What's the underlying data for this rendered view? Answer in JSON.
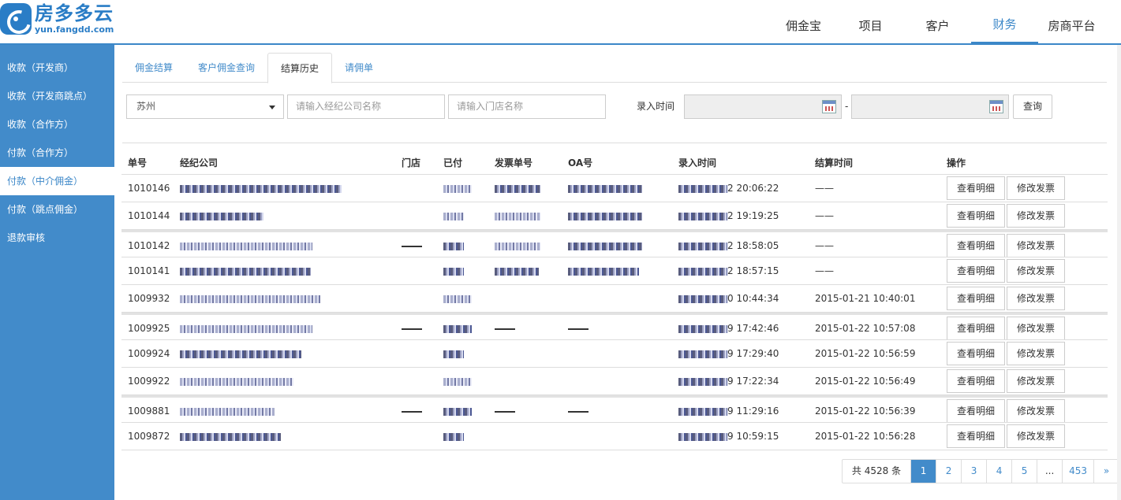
{
  "brand": {
    "name_cn": "房多多云",
    "domain": "yun.fangdd.com"
  },
  "topnav": [
    {
      "label": "佣金宝",
      "active": false
    },
    {
      "label": "项目",
      "active": false
    },
    {
      "label": "客户",
      "active": false
    },
    {
      "label": "财务",
      "active": true
    },
    {
      "label": "房商平台",
      "active": false
    }
  ],
  "sidebar": [
    {
      "label": "收款（开发商）",
      "active": false
    },
    {
      "label": "收款（开发商跳点）",
      "active": false
    },
    {
      "label": "收款（合作方）",
      "active": false
    },
    {
      "label": "付款（合作方）",
      "active": false
    },
    {
      "label": "付款（中介佣金）",
      "active": true
    },
    {
      "label": "付款（跳点佣金）",
      "active": false
    },
    {
      "label": "退款审核",
      "active": false
    }
  ],
  "tabs": [
    {
      "label": "佣金结算",
      "active": false
    },
    {
      "label": "客户佣金查询",
      "active": false
    },
    {
      "label": "结算历史",
      "active": true
    },
    {
      "label": "请佣单",
      "active": false
    }
  ],
  "filters": {
    "city": "苏州",
    "company_placeholder": "请输入经纪公司名称",
    "store_placeholder": "请输入门店名称",
    "time_label": "录入时间",
    "range_sep": "-",
    "query_button": "查询"
  },
  "table": {
    "headers": [
      "单号",
      "经纪公司",
      "门店",
      "已付",
      "发票单号",
      "OA号",
      "录入时间",
      "结算时间",
      "操作"
    ],
    "rows": [
      {
        "id": "1010146",
        "rec_suffix": "2 20:06:22",
        "settle": "——"
      },
      {
        "id": "1010144",
        "rec_suffix": "2 19:19:25",
        "settle": "——"
      },
      {
        "id": "1010142",
        "rec_suffix": "2 18:58:05",
        "settle": "——"
      },
      {
        "id": "1010141",
        "rec_suffix": "2 18:57:15",
        "settle": "——"
      },
      {
        "id": "1009932",
        "rec_suffix": "0 10:44:34",
        "settle": "2015-01-21 10:40:01"
      },
      {
        "id": "1009925",
        "rec_suffix": "9 17:42:46",
        "settle": "2015-01-22 10:57:08"
      },
      {
        "id": "1009924",
        "rec_suffix": "9 17:29:40",
        "settle": "2015-01-22 10:56:59"
      },
      {
        "id": "1009922",
        "rec_suffix": "9 17:22:34",
        "settle": "2015-01-22 10:56:49"
      },
      {
        "id": "1009881",
        "rec_suffix": "9 11:29:16",
        "settle": "2015-01-22 10:56:39"
      },
      {
        "id": "1009872",
        "rec_suffix": "9 10:59:15",
        "settle": "2015-01-22 10:56:28"
      }
    ],
    "btn_detail": "查看明细",
    "btn_invoice": "修改发票"
  },
  "pager": {
    "total": "共 4528 条",
    "pages": [
      "1",
      "2",
      "3",
      "4",
      "5",
      "...",
      "453",
      "»"
    ],
    "current": "1"
  }
}
